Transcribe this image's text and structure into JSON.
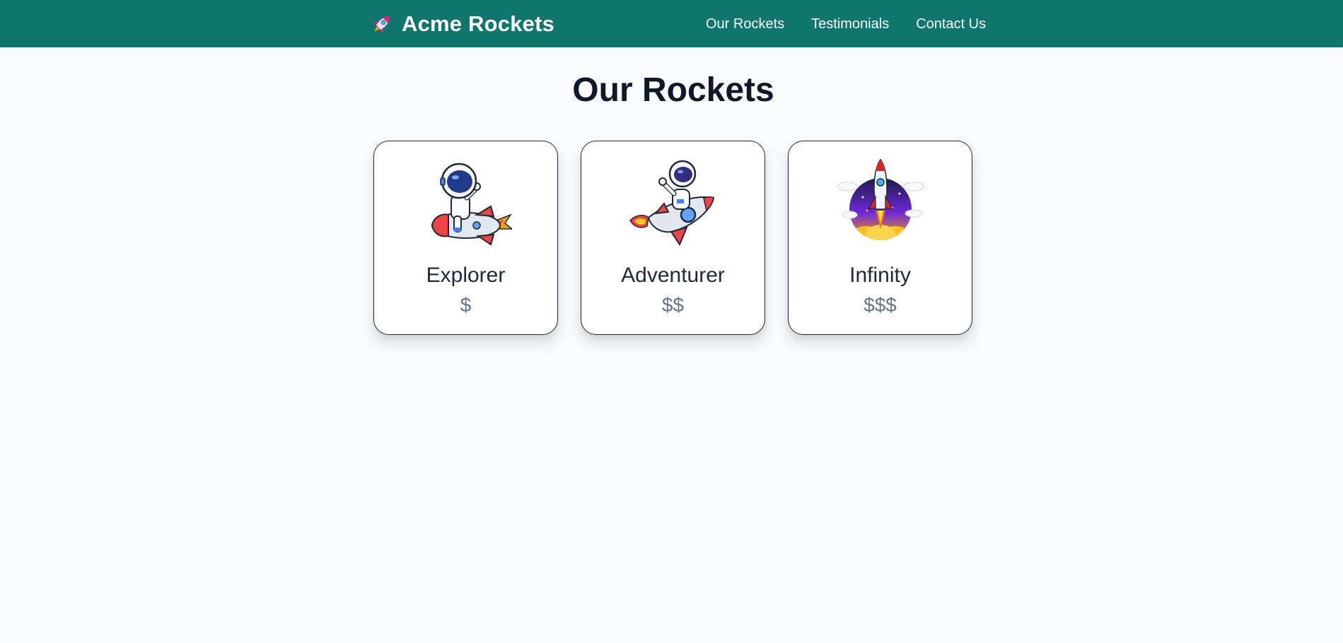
{
  "navbar": {
    "brand_icon": "rocket-icon",
    "brand_title": "Acme Rockets",
    "links": [
      {
        "label": "Our Rockets"
      },
      {
        "label": "Testimonials"
      },
      {
        "label": "Contact Us"
      }
    ]
  },
  "main": {
    "heading": "Our Rockets",
    "cards": [
      {
        "name": "Explorer",
        "price": "$",
        "image": "astronaut-riding-rocket-image"
      },
      {
        "name": "Adventurer",
        "price": "$$",
        "image": "astronaut-flying-rocket-image"
      },
      {
        "name": "Infinity",
        "price": "$$$",
        "image": "rocket-launch-image"
      }
    ]
  },
  "colors": {
    "navbar_bg": "#0f766e",
    "page_bg": "#f8fafc",
    "heading": "#0f172a",
    "price": "#64748b"
  }
}
